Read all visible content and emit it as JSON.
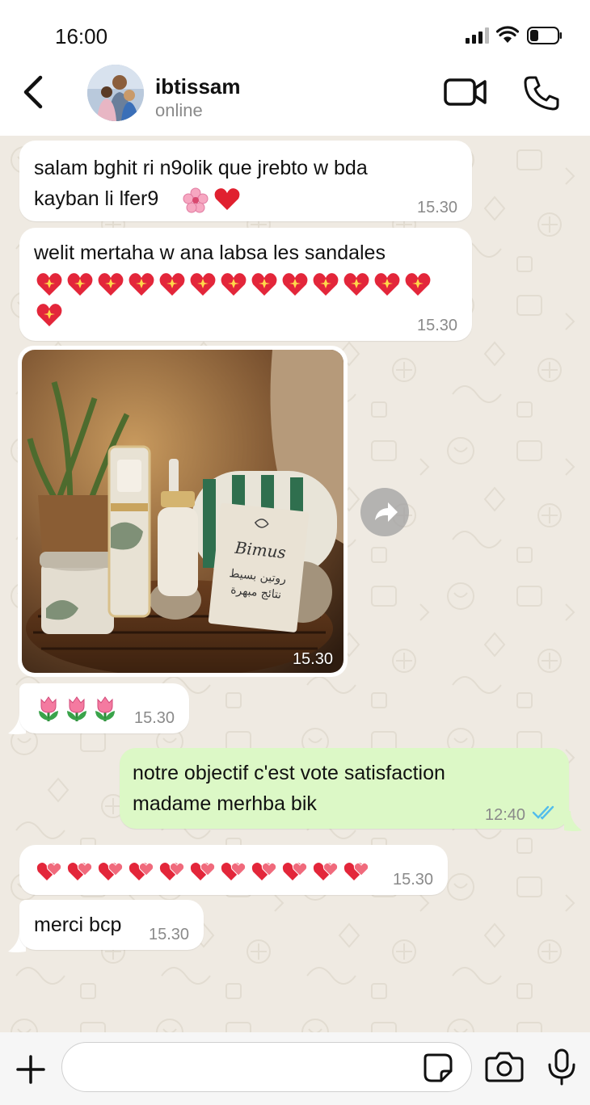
{
  "status_bar": {
    "time": "16:00"
  },
  "contact": {
    "name": "ibtissam",
    "status": "online"
  },
  "colors": {
    "incoming_bubble": "#ffffff",
    "outgoing_bubble": "#dcf8c6",
    "chat_background": "#efeae2",
    "read_ticks": "#53bdeb"
  },
  "messages": [
    {
      "direction": "incoming",
      "lines": [
        "salam bghit ri n9olik que jrebto w bda",
        "kayban li lfer9"
      ],
      "emoji": [
        "cherry-blossom",
        "red-heart"
      ],
      "time": "15.30"
    },
    {
      "direction": "incoming",
      "lines": [
        "welit mertaha w ana labsa les sandales"
      ],
      "emoji_count": 14,
      "emoji": "sparkling-heart",
      "time": "15.30"
    },
    {
      "direction": "incoming",
      "type": "image",
      "image_desc_icons": "skincare-products",
      "product_card_text": [
        "Bimus",
        "روتين بسيط",
        "نتائج مبهرة"
      ],
      "time": "15.30"
    },
    {
      "direction": "incoming",
      "emoji_count": 3,
      "emoji": "tulip",
      "time": "15.30"
    },
    {
      "direction": "outgoing",
      "lines": [
        "notre objectif c'est vote satisfaction",
        "madame merhba bik"
      ],
      "time": "12:40",
      "status": "read"
    },
    {
      "direction": "incoming",
      "emoji_count": 11,
      "emoji": "two-hearts",
      "time": "15.30"
    },
    {
      "direction": "incoming",
      "lines": [
        "merci bcp"
      ],
      "time": "15.30"
    }
  ],
  "input": {
    "placeholder": ""
  }
}
